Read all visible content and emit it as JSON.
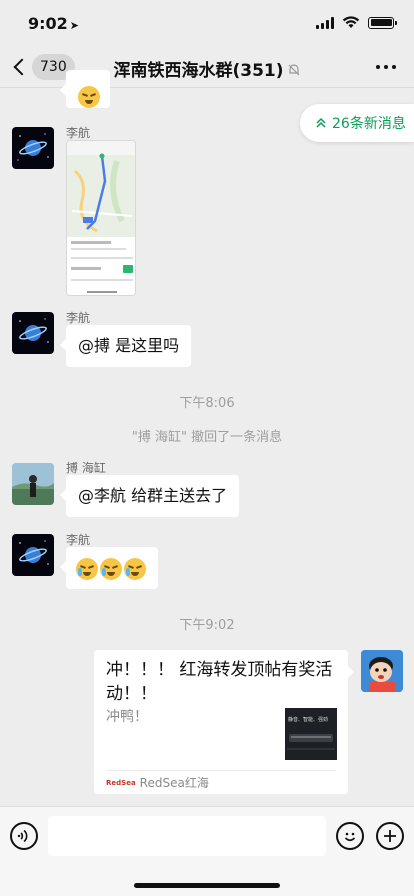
{
  "status_bar": {
    "time": "9:02",
    "location_icon": "location-arrow-icon"
  },
  "nav": {
    "unread_count": "730",
    "title": "浑南铁西海水群(351)",
    "mute_icon": "bell-slash-icon",
    "more_icon": "ellipsis-icon"
  },
  "new_messages": {
    "label": "26条新消息",
    "icon": "double-chevron-up-icon"
  },
  "messages": [
    {
      "sender": "李航",
      "type": "image",
      "image": "map-route-screenshot"
    },
    {
      "sender": "李航",
      "type": "text",
      "text": "@搏 是这里吗"
    },
    {
      "type": "timestamp",
      "text": "下午8:06"
    },
    {
      "type": "system",
      "text": "\"搏 海缸\" 撤回了一条消息"
    },
    {
      "sender": "搏 海缸",
      "type": "text",
      "text": "@李航 给群主送去了"
    },
    {
      "sender": "李航",
      "type": "emoji",
      "emoji": [
        "crying-laughing",
        "crying-laughing",
        "crying-laughing"
      ]
    },
    {
      "type": "timestamp",
      "text": "下午9:02"
    },
    {
      "sender": "self",
      "type": "link_card",
      "title": "冲！！！ 红海转发顶帖有奖活动！！",
      "description": "冲鸭！",
      "thumbnail_text": "静音、智能、强劲",
      "source": "RedSea红海",
      "source_logo": "RedSea"
    }
  ],
  "input_bar": {
    "voice_icon": "voice-icon",
    "emoji_icon": "smiley-icon",
    "plus_icon": "plus-icon"
  },
  "colors": {
    "accent": "#07a05a",
    "background": "#ededed",
    "bubble": "#ffffff"
  }
}
